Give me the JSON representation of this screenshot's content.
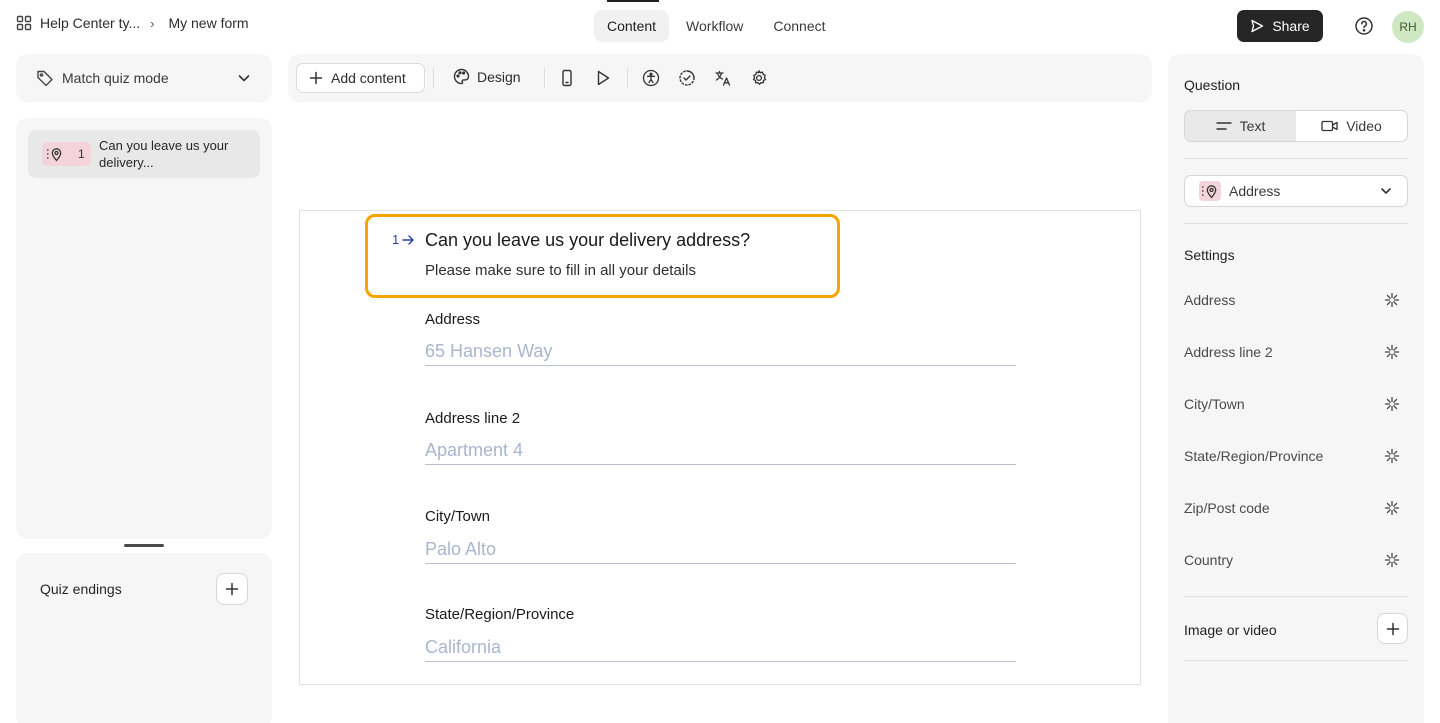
{
  "header": {
    "breadcrumb_workspace": "Help Center ty...",
    "breadcrumb_form": "My new form",
    "tabs": [
      "Content",
      "Workflow",
      "Connect"
    ],
    "active_tab": "Content",
    "share_label": "Share",
    "avatar_initials": "RH"
  },
  "sidebar": {
    "quiz_mode_label": "Match quiz mode",
    "questions": [
      {
        "number": "1",
        "text": "Can you leave us your delivery..."
      }
    ],
    "endings_label": "Quiz endings"
  },
  "toolbar": {
    "add_content_label": "Add content",
    "design_label": "Design",
    "icons": [
      "mobile-preview-icon",
      "play-icon",
      "accessibility-icon",
      "loading-icon",
      "translate-icon",
      "settings-icon"
    ]
  },
  "question": {
    "number": "1",
    "title": "Can you leave us your delivery address?",
    "description": "Please make sure to fill in all your details",
    "fields": [
      {
        "label": "Address",
        "placeholder": "65 Hansen Way"
      },
      {
        "label": "Address line 2",
        "placeholder": "Apartment 4"
      },
      {
        "label": "City/Town",
        "placeholder": "Palo Alto"
      },
      {
        "label": "State/Region/Province",
        "placeholder": "California"
      }
    ]
  },
  "right_panel": {
    "question_heading": "Question",
    "segment_text": "Text",
    "segment_video": "Video",
    "type_label": "Address",
    "settings_heading": "Settings",
    "settings": [
      "Address",
      "Address line 2",
      "City/Town",
      "State/Region/Province",
      "Zip/Post code",
      "Country"
    ],
    "image_video_label": "Image or video"
  },
  "colors": {
    "highlight": "#f5a300",
    "badge_pink": "#f5d3da",
    "share_bg": "#262626",
    "placeholder": "#a9b6cf",
    "question_number": "#2742a6"
  }
}
